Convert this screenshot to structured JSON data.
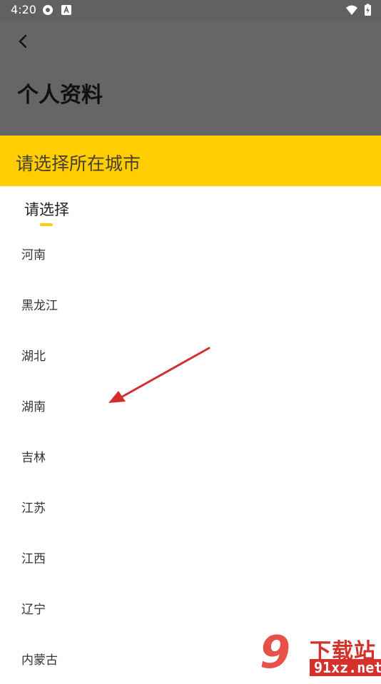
{
  "status_bar": {
    "time": "4:20"
  },
  "header": {
    "title": "个人资料"
  },
  "banner": {
    "text": "请选择所在城市"
  },
  "tab": {
    "label": "请选择"
  },
  "provinces": [
    "河南",
    "黑龙江",
    "湖北",
    "湖南",
    "吉林",
    "江苏",
    "江西",
    "辽宁",
    "内蒙古"
  ],
  "watermark": {
    "brand": "下载站",
    "site": "91xz.net",
    "number": "9"
  },
  "colors": {
    "header_bg": "#666666",
    "accent": "#ffcd00",
    "arrow": "#d32f2f"
  }
}
